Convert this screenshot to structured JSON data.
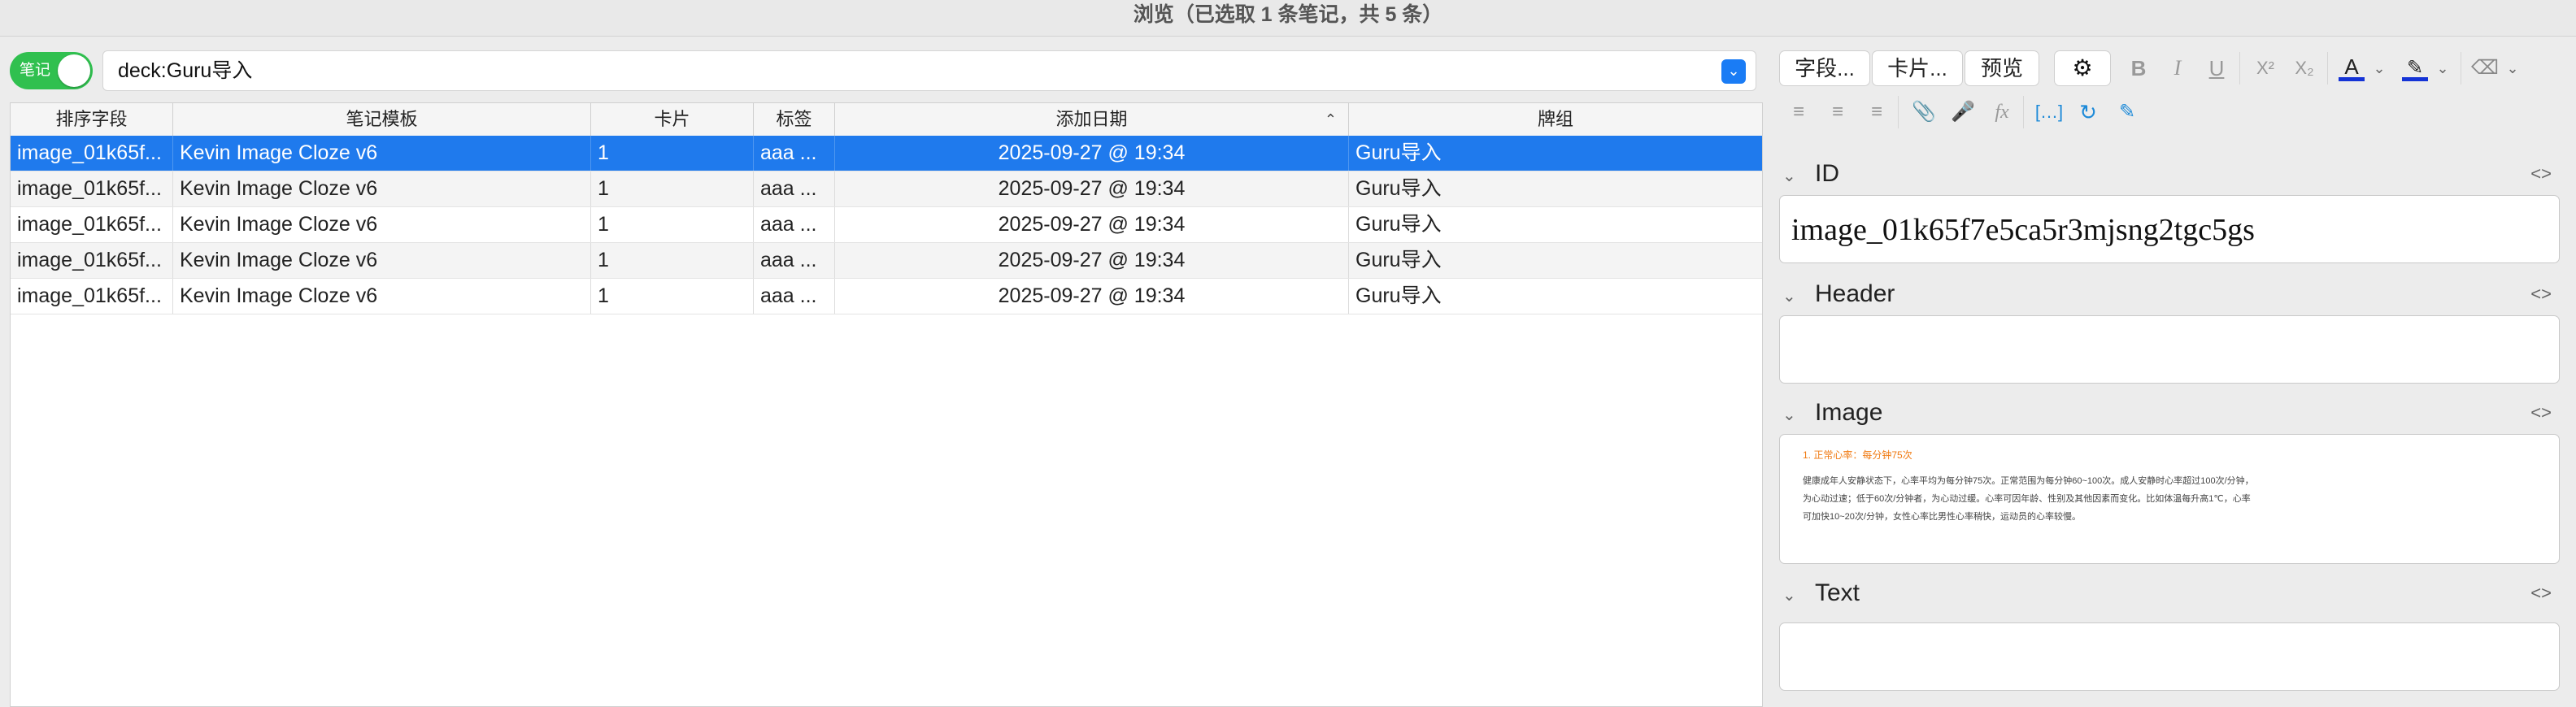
{
  "window": {
    "title": "浏览（已选取 1 条笔记，共 5 条）"
  },
  "toggle": {
    "label": "笔记",
    "on": true
  },
  "search": {
    "value": "deck:Guru导入"
  },
  "table": {
    "headers": [
      "排序字段",
      "笔记模板",
      "卡片",
      "标签",
      "添加日期",
      "牌组"
    ],
    "sorted_column": "添加日期",
    "rows": [
      {
        "sort": "image_01k65f...",
        "notetype": "Kevin Image Cloze v6",
        "cards": "1",
        "tags": "aaa ...",
        "date": "2025-09-27 @ 19:34",
        "deck": "Guru导入"
      },
      {
        "sort": "image_01k65f...",
        "notetype": "Kevin Image Cloze v6",
        "cards": "1",
        "tags": "aaa ...",
        "date": "2025-09-27 @ 19:34",
        "deck": "Guru导入"
      },
      {
        "sort": "image_01k65f...",
        "notetype": "Kevin Image Cloze v6",
        "cards": "1",
        "tags": "aaa ...",
        "date": "2025-09-27 @ 19:34",
        "deck": "Guru导入"
      },
      {
        "sort": "image_01k65f...",
        "notetype": "Kevin Image Cloze v6",
        "cards": "1",
        "tags": "aaa ...",
        "date": "2025-09-27 @ 19:34",
        "deck": "Guru导入"
      },
      {
        "sort": "image_01k65f...",
        "notetype": "Kevin Image Cloze v6",
        "cards": "1",
        "tags": "aaa ...",
        "date": "2025-09-27 @ 19:34",
        "deck": "Guru导入"
      }
    ]
  },
  "editor": {
    "buttons": {
      "fields": "字段...",
      "cards": "卡片...",
      "preview": "预览"
    },
    "format_icons": [
      "gear-icon",
      "bold-icon",
      "italic-icon",
      "underline-icon",
      "superscript-icon",
      "subscript-icon",
      "text-color-icon",
      "highlight-icon",
      "eraser-icon"
    ],
    "format_glyphs": {
      "bold": "B",
      "italic": "I",
      "underline": "U",
      "superscript": "X²",
      "subscript": "X₂",
      "text_color": "A"
    },
    "second_row_icons": [
      "bullet-list-icon",
      "numbered-list-icon",
      "align-icon",
      "attachment-icon",
      "microphone-icon",
      "formula-icon",
      "cloze-icon",
      "refresh-icon",
      "edit-icon"
    ],
    "colors": {
      "text_color": "#1433d6",
      "highlight": "#1433d6",
      "toggle_green": "#30c04f",
      "selection_blue": "#1f7aed"
    },
    "fields": [
      {
        "name": "ID",
        "value": "image_01k65f7e5ca5r3mjsng2tgc5gs"
      },
      {
        "name": "Header",
        "value": ""
      },
      {
        "name": "Image",
        "value": "",
        "image_text": {
          "title": "1. 正常心率：每分钟75次",
          "body": "健康成年人安静状态下，心率平均为每分钟75次。正常范围为每分钟60~100次。成人安静时心率超过100次/分钟，为心动过速；低于60次/分钟者，为心动过缓。心率可因年龄、性别及其他因素而变化。比如体温每升高1℃，心率可加快10~20次/分钟，女性心率比男性心率稍快，运动员的心率较慢。"
        }
      },
      {
        "name": "Text",
        "value": ""
      }
    ]
  }
}
